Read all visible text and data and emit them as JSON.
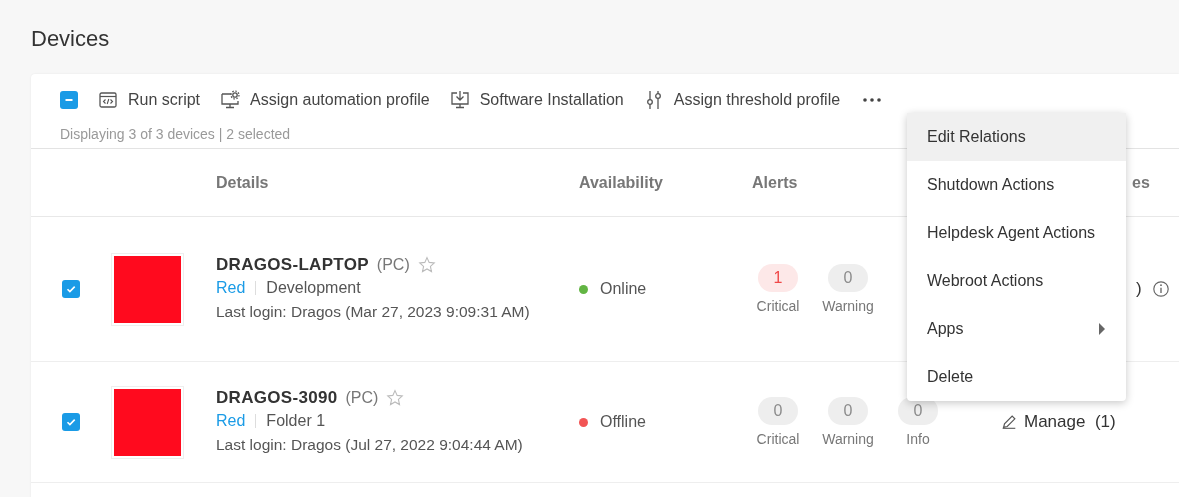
{
  "page_title": "Devices",
  "toolbar": {
    "select_all": {
      "checked": true,
      "indeterminate": true
    },
    "actions": [
      {
        "label": "Run script",
        "kind": "script"
      },
      {
        "label": "Assign automation profile",
        "kind": "automation"
      },
      {
        "label": "Software Installation",
        "kind": "install"
      },
      {
        "label": "Assign threshold profile",
        "kind": "threshold"
      }
    ],
    "status": "Displaying 3 of 3 devices | 2 selected"
  },
  "table": {
    "columns": [
      {
        "label": "Details"
      },
      {
        "label": "Availability"
      },
      {
        "label": "Alerts"
      },
      {
        "label": "es"
      }
    ],
    "rows": [
      {
        "checked": true,
        "name": "DRAGOS-LAPTOP",
        "type": "(PC)",
        "starred": false,
        "tag": "Red",
        "folder": "Development",
        "last_login": "Last login: Dragos (Mar 27, 2023 9:09:31 AM)",
        "status": "Online",
        "online": true,
        "alerts": [
          {
            "kind": "critical",
            "count": "1",
            "label": "Critical"
          },
          {
            "kind": "none",
            "count": "0",
            "label": "Warning"
          }
        ],
        "manage": {
          "kind": "fragment",
          "text": ")",
          "info": true
        }
      },
      {
        "checked": true,
        "name": "DRAGOS-3090",
        "type": "(PC)",
        "starred": false,
        "tag": "Red",
        "folder": "Folder 1",
        "last_login": "Last login: Dragos (Jul 27, 2022 9:04:44 AM)",
        "status": "Offline",
        "online": false,
        "alerts": [
          {
            "kind": "none",
            "count": "0",
            "label": "Critical"
          },
          {
            "kind": "none",
            "count": "0",
            "label": "Warning"
          },
          {
            "kind": "none",
            "count": "0",
            "label": "Info"
          }
        ],
        "manage": {
          "kind": "link",
          "text": "Manage",
          "count": "(1)",
          "info": false
        }
      }
    ]
  },
  "menu": {
    "items": [
      {
        "label": "Edit Relations",
        "hovered": true,
        "submenu": false
      },
      {
        "label": "Shutdown Actions",
        "hovered": false,
        "submenu": false
      },
      {
        "label": "Helpdesk Agent Actions",
        "hovered": false,
        "submenu": false
      },
      {
        "label": "Webroot Actions",
        "hovered": false,
        "submenu": false
      },
      {
        "label": "Apps",
        "hovered": false,
        "submenu": true
      },
      {
        "label": "Delete",
        "hovered": false,
        "submenu": false
      }
    ]
  }
}
